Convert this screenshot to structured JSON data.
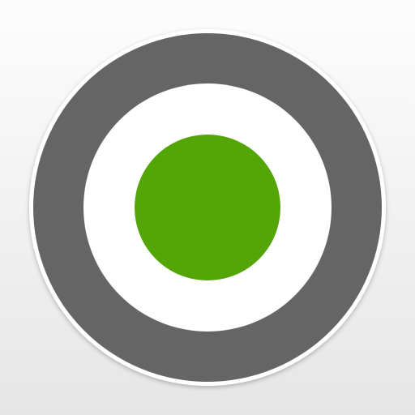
{
  "icon": {
    "name": "target-icon",
    "colors": {
      "background_top": "#FDFDFD",
      "background_bottom": "#E6E6E6",
      "outer_border": "#FFFFFF",
      "outer_ring": "#656565",
      "inner_ring": "#FFFFFF",
      "center_dot": "#54A608"
    }
  }
}
